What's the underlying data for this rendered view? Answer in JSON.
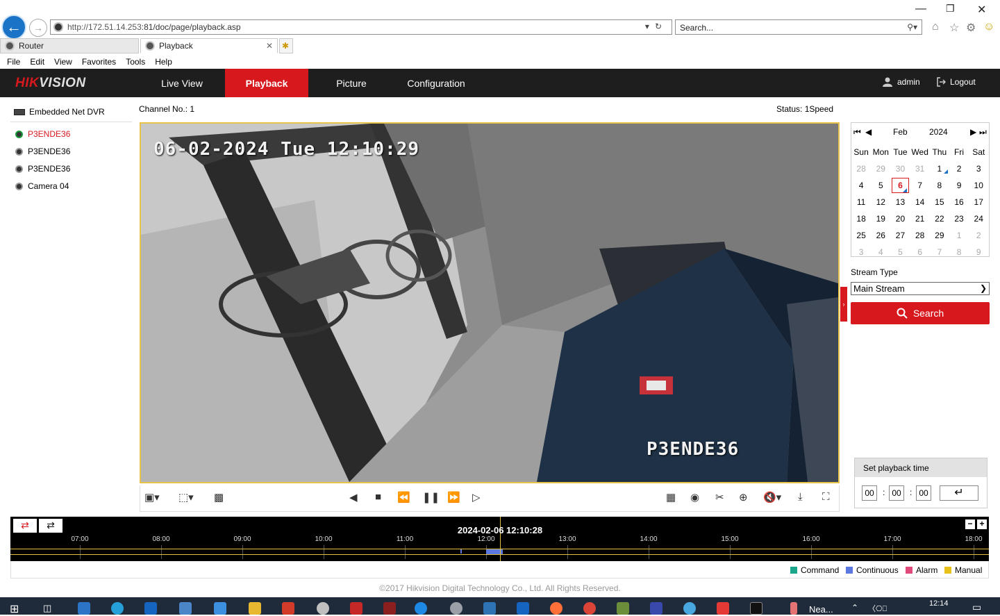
{
  "browser": {
    "url_host": "http://172.51.14.253",
    "url_rest": ":81/doc/page/playback.asp",
    "search_placeholder": "Search...",
    "tabs": [
      {
        "label": "Router"
      },
      {
        "label": "Playback"
      }
    ],
    "menu": [
      "File",
      "Edit",
      "View",
      "Favorites",
      "Tools",
      "Help"
    ]
  },
  "app": {
    "brand_red": "HIK",
    "brand_rest": "VISION",
    "nav": [
      {
        "label": "Live View",
        "active": false
      },
      {
        "label": "Playback",
        "active": true
      },
      {
        "label": "Picture",
        "active": false
      },
      {
        "label": "Configuration",
        "active": false
      }
    ],
    "user": "admin",
    "logout": "Logout",
    "accent": "#d7191e"
  },
  "sidebar": {
    "device": "Embedded Net DVR",
    "cameras": [
      {
        "label": "P3ENDE36",
        "selected": true
      },
      {
        "label": "P3ENDE36",
        "selected": false
      },
      {
        "label": "P3ENDE36",
        "selected": false
      },
      {
        "label": "Camera 04",
        "selected": false
      }
    ]
  },
  "player": {
    "channel": "Channel No.: 1",
    "status": "Status: 1Speed",
    "osd_datetime": "06-02-2024 Tue 12:10:29",
    "osd_name": "P3ENDE36"
  },
  "calendar": {
    "month": "Feb",
    "year": "2024",
    "weekdays": [
      "Sun",
      "Mon",
      "Tue",
      "Wed",
      "Thu",
      "Fri",
      "Sat"
    ],
    "days": [
      "28",
      "29",
      "30",
      "31",
      "1",
      "2",
      "3",
      "4",
      "5",
      "6",
      "7",
      "8",
      "9",
      "10",
      "11",
      "12",
      "13",
      "14",
      "15",
      "16",
      "17",
      "18",
      "19",
      "20",
      "21",
      "22",
      "23",
      "24",
      "25",
      "26",
      "27",
      "28",
      "29",
      "1",
      "2",
      "3",
      "4",
      "5",
      "6",
      "7",
      "8",
      "9"
    ],
    "selected": "6",
    "days_with_recordings": [
      "1",
      "6"
    ]
  },
  "stream": {
    "label": "Stream Type",
    "value": "Main Stream",
    "search": "Search"
  },
  "playback_time": {
    "title": "Set playback time",
    "hh": "00",
    "mm": "00",
    "ss": "00"
  },
  "timeline": {
    "current": "2024-02-06 12:10:28",
    "ticks": [
      "07:00",
      "08:00",
      "09:00",
      "10:00",
      "11:00",
      "12:00",
      "13:00",
      "14:00",
      "15:00",
      "16:00",
      "17:00",
      "18:00"
    ],
    "legend": [
      {
        "label": "Command",
        "color": "#1aa68a"
      },
      {
        "label": "Continuous",
        "color": "#5a78e0"
      },
      {
        "label": "Alarm",
        "color": "#e04a7a"
      },
      {
        "label": "Manual",
        "color": "#e8c21a"
      }
    ]
  },
  "footer": "©2017 Hikvision Digital Technology Co., Ltd. All Rights Reserved.",
  "taskbar": {
    "pinned_text": "Nea...",
    "clock": "12:14"
  }
}
